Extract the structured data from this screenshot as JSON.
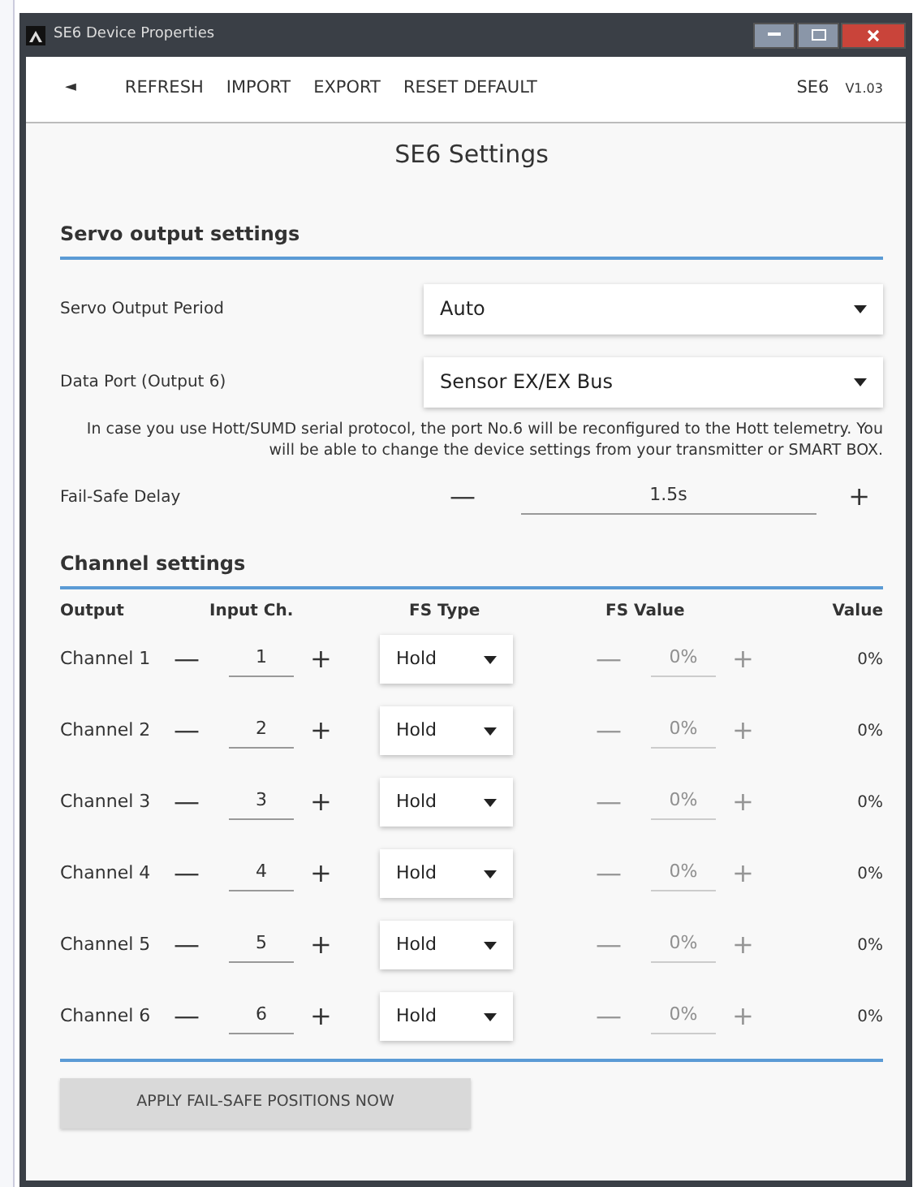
{
  "window": {
    "title": "SE6 Device Properties"
  },
  "toolbar": {
    "back": "◄",
    "actions": [
      "REFRESH",
      "IMPORT",
      "EXPORT",
      "RESET DEFAULT"
    ],
    "device": "SE6",
    "version": "V1.03"
  },
  "page_title": "SE6 Settings",
  "servo_section": {
    "heading": "Servo output settings",
    "fields": [
      {
        "label": "Servo Output Period",
        "value": "Auto"
      },
      {
        "label": "Data Port (Output 6)",
        "value": "Sensor EX/EX Bus"
      }
    ],
    "note": "In case you use Hott/SUMD serial protocol, the port No.6 will be reconfigured to the Hott telemetry. You will be able to change the device settings from your transmitter or SMART BOX.",
    "failsafe_delay": {
      "label": "Fail-Safe Delay",
      "minus": "—",
      "value": "1.5s",
      "plus": "+"
    }
  },
  "channel_section": {
    "heading": "Channel settings",
    "columns": [
      "Output",
      "Input Ch.",
      "FS Type",
      "FS Value",
      "Value"
    ],
    "rows": [
      {
        "output": "Channel 1",
        "input": "1",
        "fs_type": "Hold",
        "fs_value": "0%",
        "fs_value_disabled": true,
        "value": "0%"
      },
      {
        "output": "Channel 2",
        "input": "2",
        "fs_type": "Hold",
        "fs_value": "0%",
        "fs_value_disabled": true,
        "value": "0%"
      },
      {
        "output": "Channel 3",
        "input": "3",
        "fs_type": "Hold",
        "fs_value": "0%",
        "fs_value_disabled": true,
        "value": "0%"
      },
      {
        "output": "Channel 4",
        "input": "4",
        "fs_type": "Hold",
        "fs_value": "0%",
        "fs_value_disabled": true,
        "value": "0%"
      },
      {
        "output": "Channel 5",
        "input": "5",
        "fs_type": "Hold",
        "fs_value": "0%",
        "fs_value_disabled": true,
        "value": "0%"
      },
      {
        "output": "Channel 6",
        "input": "6",
        "fs_type": "Hold",
        "fs_value": "0%",
        "fs_value_disabled": true,
        "value": "0%"
      }
    ],
    "stepper": {
      "minus": "—",
      "plus": "+"
    }
  },
  "apply_button": "APPLY FAIL-SAFE POSITIONS NOW"
}
